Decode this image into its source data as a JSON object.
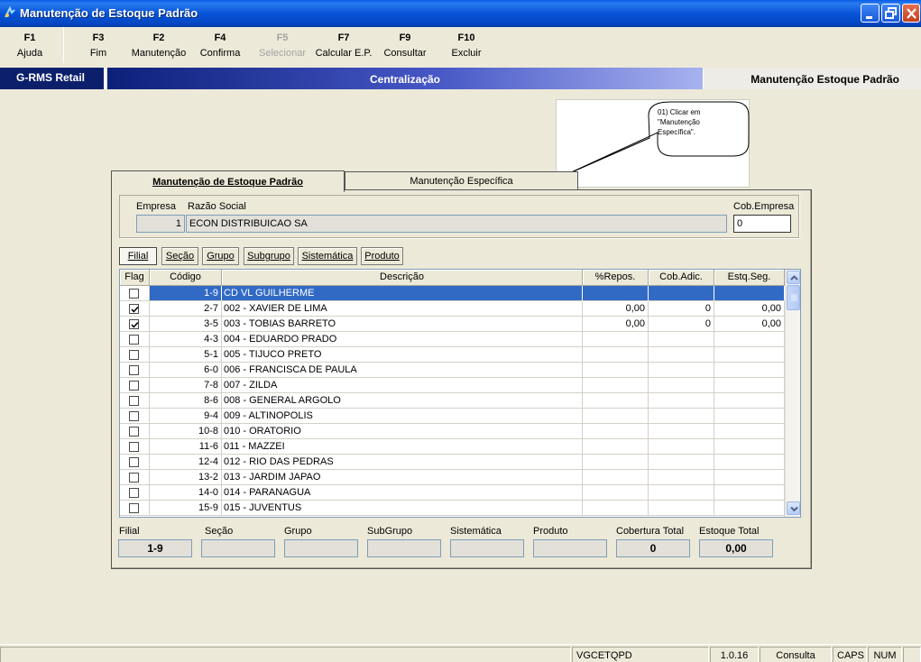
{
  "window": {
    "title": "Manutenção de Estoque Padrão",
    "icon": "app-icon"
  },
  "fkeys": [
    {
      "key": "F1",
      "label": "Ajuda",
      "enabled": true
    },
    {
      "key": "F3",
      "label": "Fim",
      "enabled": true
    },
    {
      "key": "F2",
      "label": "Manutenção",
      "enabled": true
    },
    {
      "key": "F4",
      "label": "Confirma",
      "enabled": true
    },
    {
      "key": "F5",
      "label": "Selecionar",
      "enabled": false
    },
    {
      "key": "F7",
      "label": "Calcular E.P.",
      "enabled": true
    },
    {
      "key": "F9",
      "label": "Consultar",
      "enabled": true
    },
    {
      "key": "F10",
      "label": "Excluir",
      "enabled": true
    }
  ],
  "banner": {
    "left": "G-RMS Retail",
    "center": "Centralização",
    "right": "Manutenção Estoque Padrão"
  },
  "callout": {
    "text": "01) Clicar em \"Manutenção Específica\"."
  },
  "tabs": [
    {
      "label": "Manutenção de Estoque Padrão",
      "active": true
    },
    {
      "label": "Manutenção Específica",
      "active": false
    }
  ],
  "company": {
    "empresa_label": "Empresa",
    "razao_label": "Razão Social",
    "cob_label": "Cob.Empresa",
    "empresa_value": "1",
    "razao_value": "ECON DISTRIBUICAO SA",
    "cob_value": "0"
  },
  "subtabs": [
    {
      "label": "Filial",
      "active": true
    },
    {
      "label": "Seção",
      "active": false
    },
    {
      "label": "Grupo",
      "active": false
    },
    {
      "label": "Subgrupo",
      "active": false
    },
    {
      "label": "Sistemática",
      "active": false
    },
    {
      "label": "Produto",
      "active": false
    }
  ],
  "grid": {
    "columns": [
      "Flag",
      "Código",
      "Descrição",
      "%Repos.",
      "Cob.Adic.",
      "Estq.Seg."
    ],
    "rows": [
      {
        "flag": false,
        "codigo": "1-9",
        "descricao": "CD VL GUILHERME",
        "repos": "",
        "cob": "",
        "estq": "",
        "selected": true
      },
      {
        "flag": true,
        "codigo": "2-7",
        "descricao": "002 - XAVIER DE LIMA",
        "repos": "0,00",
        "cob": "0",
        "estq": "0,00",
        "selected": false
      },
      {
        "flag": true,
        "codigo": "3-5",
        "descricao": "003 - TOBIAS BARRETO",
        "repos": "0,00",
        "cob": "0",
        "estq": "0,00",
        "selected": false
      },
      {
        "flag": false,
        "codigo": "4-3",
        "descricao": "004 - EDUARDO PRADO",
        "repos": "",
        "cob": "",
        "estq": "",
        "selected": false
      },
      {
        "flag": false,
        "codigo": "5-1",
        "descricao": "005 - TIJUCO PRETO",
        "repos": "",
        "cob": "",
        "estq": "",
        "selected": false
      },
      {
        "flag": false,
        "codigo": "6-0",
        "descricao": "006 - FRANCISCA DE PAULA",
        "repos": "",
        "cob": "",
        "estq": "",
        "selected": false
      },
      {
        "flag": false,
        "codigo": "7-8",
        "descricao": "007 - ZILDA",
        "repos": "",
        "cob": "",
        "estq": "",
        "selected": false
      },
      {
        "flag": false,
        "codigo": "8-6",
        "descricao": "008 - GENERAL ARGOLO",
        "repos": "",
        "cob": "",
        "estq": "",
        "selected": false
      },
      {
        "flag": false,
        "codigo": "9-4",
        "descricao": "009 - ALTINOPOLIS",
        "repos": "",
        "cob": "",
        "estq": "",
        "selected": false
      },
      {
        "flag": false,
        "codigo": "10-8",
        "descricao": "010 - ORATORIO",
        "repos": "",
        "cob": "",
        "estq": "",
        "selected": false
      },
      {
        "flag": false,
        "codigo": "11-6",
        "descricao": "011 - MAZZEI",
        "repos": "",
        "cob": "",
        "estq": "",
        "selected": false
      },
      {
        "flag": false,
        "codigo": "12-4",
        "descricao": "012 - RIO DAS PEDRAS",
        "repos": "",
        "cob": "",
        "estq": "",
        "selected": false
      },
      {
        "flag": false,
        "codigo": "13-2",
        "descricao": "013 - JARDIM JAPAO",
        "repos": "",
        "cob": "",
        "estq": "",
        "selected": false
      },
      {
        "flag": false,
        "codigo": "14-0",
        "descricao": "014 - PARANAGUA",
        "repos": "",
        "cob": "",
        "estq": "",
        "selected": false
      },
      {
        "flag": false,
        "codigo": "15-9",
        "descricao": "015 - JUVENTUS",
        "repos": "",
        "cob": "",
        "estq": "",
        "selected": false
      }
    ]
  },
  "footer": {
    "filial_label": "Filial",
    "filial_value": "1-9",
    "secao_label": "Seção",
    "secao_value": "",
    "grupo_label": "Grupo",
    "grupo_value": "",
    "subgrupo_label": "SubGrupo",
    "subgrupo_value": "",
    "sistematica_label": "Sistemática",
    "sistematica_value": "",
    "produto_label": "Produto",
    "produto_value": "",
    "cobertura_label": "Cobertura Total",
    "cobertura_value": "0",
    "estoque_label": "Estoque Total",
    "estoque_value": "0,00"
  },
  "statusbar": {
    "program": "VGCETQPD",
    "version": "1.0.16",
    "mode": "Consulta",
    "caps": "CAPS",
    "num": "NUM"
  },
  "colors": {
    "selection": "#316AC5",
    "titlebar": "#0753D8",
    "banner_dark": "#0B1F6B"
  }
}
